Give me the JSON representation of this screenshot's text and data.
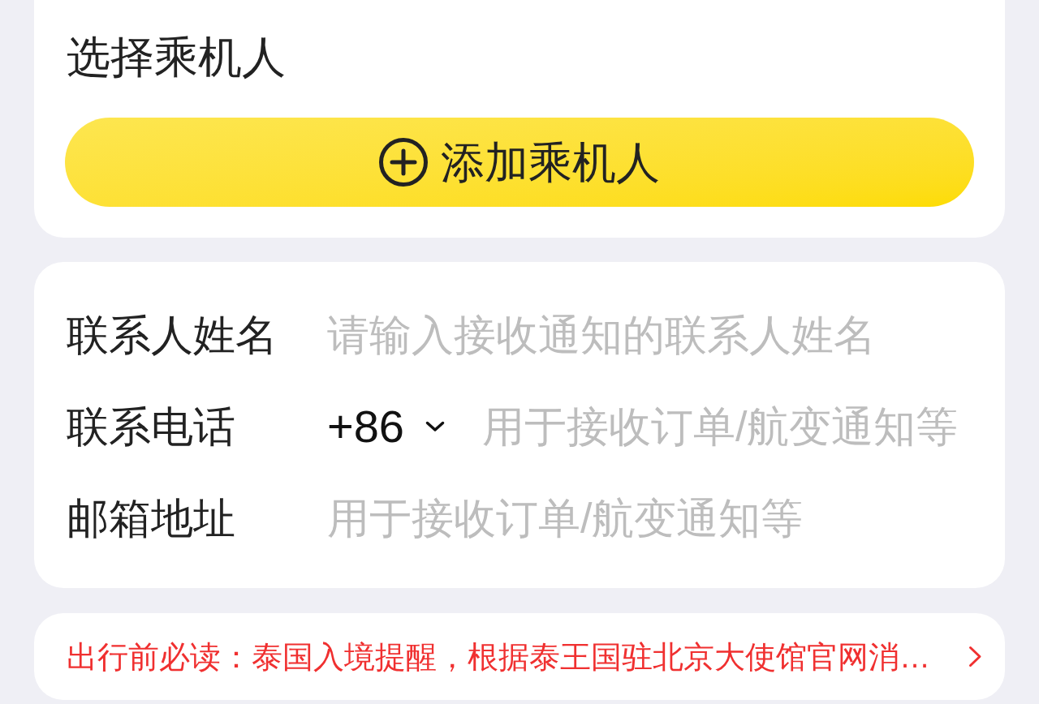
{
  "passenger_section": {
    "title": "选择乘机人",
    "add_button": {
      "label": "添加乘机人"
    }
  },
  "contact_form": {
    "fields": [
      {
        "kind": "text",
        "label": "联系人姓名",
        "placeholder": "请输入接收通知的联系人姓名"
      },
      {
        "kind": "phone",
        "label": "联系电话",
        "country_code": "+86",
        "placeholder": "用于接收订单/航变通知等"
      },
      {
        "kind": "text",
        "label": "邮箱地址",
        "placeholder": "用于接收订单/航变通知等"
      }
    ]
  },
  "notice": {
    "text": "出行前必读：泰国入境提醒，根据泰王国驻北京大使馆官网消…"
  }
}
